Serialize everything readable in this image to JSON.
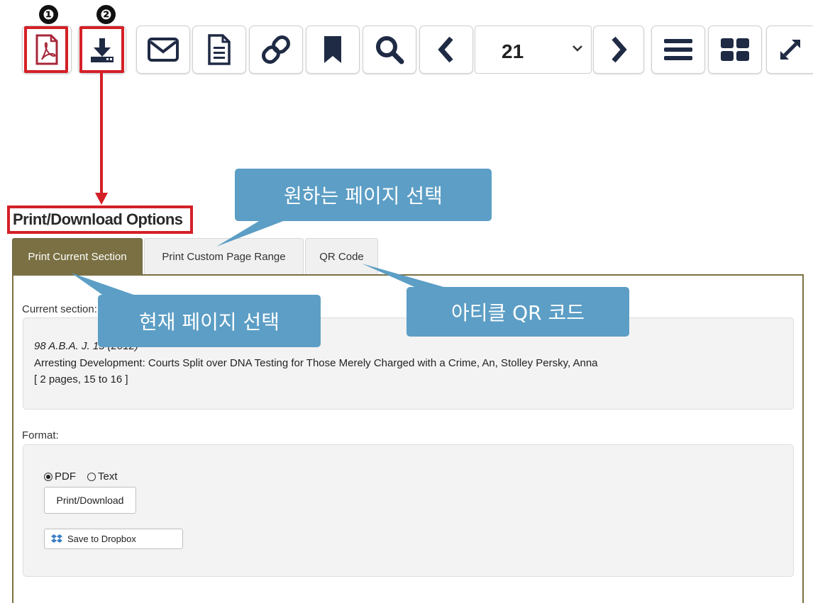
{
  "toolbar": {
    "buttons": [
      "pdf-icon",
      "download-icon",
      "envelope-icon",
      "document-icon",
      "link-icon",
      "bookmark-icon",
      "search-icon",
      "chevron-left-icon",
      "chevron-right-icon",
      "menu-icon",
      "grid-icon",
      "expand-icon"
    ],
    "page_number": "21",
    "markers": [
      "❶",
      "❷"
    ]
  },
  "panel": {
    "title": "Print/Download Options",
    "tabs": [
      "Print Current Section",
      "Print Custom Page Range",
      "QR Code"
    ],
    "current_section_label": "Current section:",
    "citation": "98 A.B.A. J. 15 (2012)",
    "article": "Arresting Development: Courts Split over DNA Testing for Those Merely Charged with a Crime, An, Stolley Persky, Anna",
    "pages": "[ 2 pages, 15 to 16 ]",
    "format_label": "Format:",
    "format_options": [
      "PDF",
      "Text"
    ],
    "selected_format": "PDF",
    "print_button": "Print/Download",
    "dropbox_button": "Save to Dropbox"
  },
  "callouts": {
    "select_pages": "원하는 페이지 선택",
    "current_page": "현재 페이지 선택",
    "qr_code": "아티클 QR 코드"
  },
  "colors": {
    "accent_red": "#d42027",
    "tab_active": "#7a7043",
    "callout_blue": "#5c9ec5",
    "icon_red": "#a8273a",
    "icon_navy": "#1f2a44"
  }
}
